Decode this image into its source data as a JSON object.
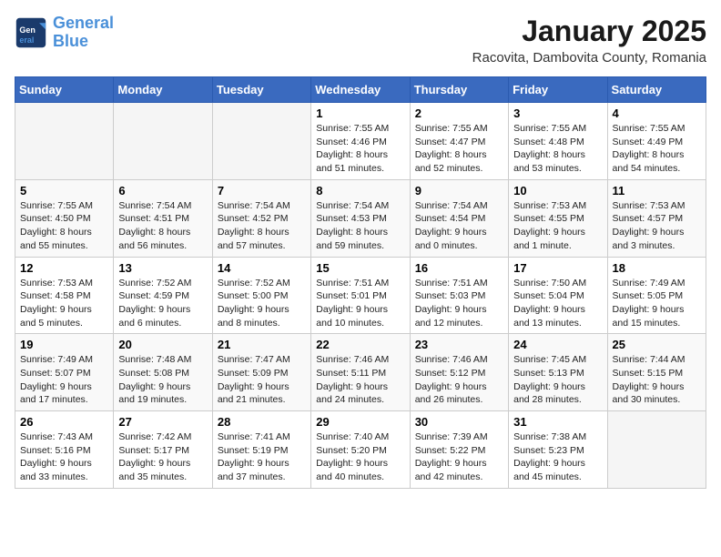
{
  "header": {
    "logo_line1": "General",
    "logo_line2": "Blue",
    "month": "January 2025",
    "location": "Racovita, Dambovita County, Romania"
  },
  "weekdays": [
    "Sunday",
    "Monday",
    "Tuesday",
    "Wednesday",
    "Thursday",
    "Friday",
    "Saturday"
  ],
  "weeks": [
    [
      {
        "day": "",
        "info": ""
      },
      {
        "day": "",
        "info": ""
      },
      {
        "day": "",
        "info": ""
      },
      {
        "day": "1",
        "info": "Sunrise: 7:55 AM\nSunset: 4:46 PM\nDaylight: 8 hours and 51 minutes."
      },
      {
        "day": "2",
        "info": "Sunrise: 7:55 AM\nSunset: 4:47 PM\nDaylight: 8 hours and 52 minutes."
      },
      {
        "day": "3",
        "info": "Sunrise: 7:55 AM\nSunset: 4:48 PM\nDaylight: 8 hours and 53 minutes."
      },
      {
        "day": "4",
        "info": "Sunrise: 7:55 AM\nSunset: 4:49 PM\nDaylight: 8 hours and 54 minutes."
      }
    ],
    [
      {
        "day": "5",
        "info": "Sunrise: 7:55 AM\nSunset: 4:50 PM\nDaylight: 8 hours and 55 minutes."
      },
      {
        "day": "6",
        "info": "Sunrise: 7:54 AM\nSunset: 4:51 PM\nDaylight: 8 hours and 56 minutes."
      },
      {
        "day": "7",
        "info": "Sunrise: 7:54 AM\nSunset: 4:52 PM\nDaylight: 8 hours and 57 minutes."
      },
      {
        "day": "8",
        "info": "Sunrise: 7:54 AM\nSunset: 4:53 PM\nDaylight: 8 hours and 59 minutes."
      },
      {
        "day": "9",
        "info": "Sunrise: 7:54 AM\nSunset: 4:54 PM\nDaylight: 9 hours and 0 minutes."
      },
      {
        "day": "10",
        "info": "Sunrise: 7:53 AM\nSunset: 4:55 PM\nDaylight: 9 hours and 1 minute."
      },
      {
        "day": "11",
        "info": "Sunrise: 7:53 AM\nSunset: 4:57 PM\nDaylight: 9 hours and 3 minutes."
      }
    ],
    [
      {
        "day": "12",
        "info": "Sunrise: 7:53 AM\nSunset: 4:58 PM\nDaylight: 9 hours and 5 minutes."
      },
      {
        "day": "13",
        "info": "Sunrise: 7:52 AM\nSunset: 4:59 PM\nDaylight: 9 hours and 6 minutes."
      },
      {
        "day": "14",
        "info": "Sunrise: 7:52 AM\nSunset: 5:00 PM\nDaylight: 9 hours and 8 minutes."
      },
      {
        "day": "15",
        "info": "Sunrise: 7:51 AM\nSunset: 5:01 PM\nDaylight: 9 hours and 10 minutes."
      },
      {
        "day": "16",
        "info": "Sunrise: 7:51 AM\nSunset: 5:03 PM\nDaylight: 9 hours and 12 minutes."
      },
      {
        "day": "17",
        "info": "Sunrise: 7:50 AM\nSunset: 5:04 PM\nDaylight: 9 hours and 13 minutes."
      },
      {
        "day": "18",
        "info": "Sunrise: 7:49 AM\nSunset: 5:05 PM\nDaylight: 9 hours and 15 minutes."
      }
    ],
    [
      {
        "day": "19",
        "info": "Sunrise: 7:49 AM\nSunset: 5:07 PM\nDaylight: 9 hours and 17 minutes."
      },
      {
        "day": "20",
        "info": "Sunrise: 7:48 AM\nSunset: 5:08 PM\nDaylight: 9 hours and 19 minutes."
      },
      {
        "day": "21",
        "info": "Sunrise: 7:47 AM\nSunset: 5:09 PM\nDaylight: 9 hours and 21 minutes."
      },
      {
        "day": "22",
        "info": "Sunrise: 7:46 AM\nSunset: 5:11 PM\nDaylight: 9 hours and 24 minutes."
      },
      {
        "day": "23",
        "info": "Sunrise: 7:46 AM\nSunset: 5:12 PM\nDaylight: 9 hours and 26 minutes."
      },
      {
        "day": "24",
        "info": "Sunrise: 7:45 AM\nSunset: 5:13 PM\nDaylight: 9 hours and 28 minutes."
      },
      {
        "day": "25",
        "info": "Sunrise: 7:44 AM\nSunset: 5:15 PM\nDaylight: 9 hours and 30 minutes."
      }
    ],
    [
      {
        "day": "26",
        "info": "Sunrise: 7:43 AM\nSunset: 5:16 PM\nDaylight: 9 hours and 33 minutes."
      },
      {
        "day": "27",
        "info": "Sunrise: 7:42 AM\nSunset: 5:17 PM\nDaylight: 9 hours and 35 minutes."
      },
      {
        "day": "28",
        "info": "Sunrise: 7:41 AM\nSunset: 5:19 PM\nDaylight: 9 hours and 37 minutes."
      },
      {
        "day": "29",
        "info": "Sunrise: 7:40 AM\nSunset: 5:20 PM\nDaylight: 9 hours and 40 minutes."
      },
      {
        "day": "30",
        "info": "Sunrise: 7:39 AM\nSunset: 5:22 PM\nDaylight: 9 hours and 42 minutes."
      },
      {
        "day": "31",
        "info": "Sunrise: 7:38 AM\nSunset: 5:23 PM\nDaylight: 9 hours and 45 minutes."
      },
      {
        "day": "",
        "info": ""
      }
    ]
  ]
}
